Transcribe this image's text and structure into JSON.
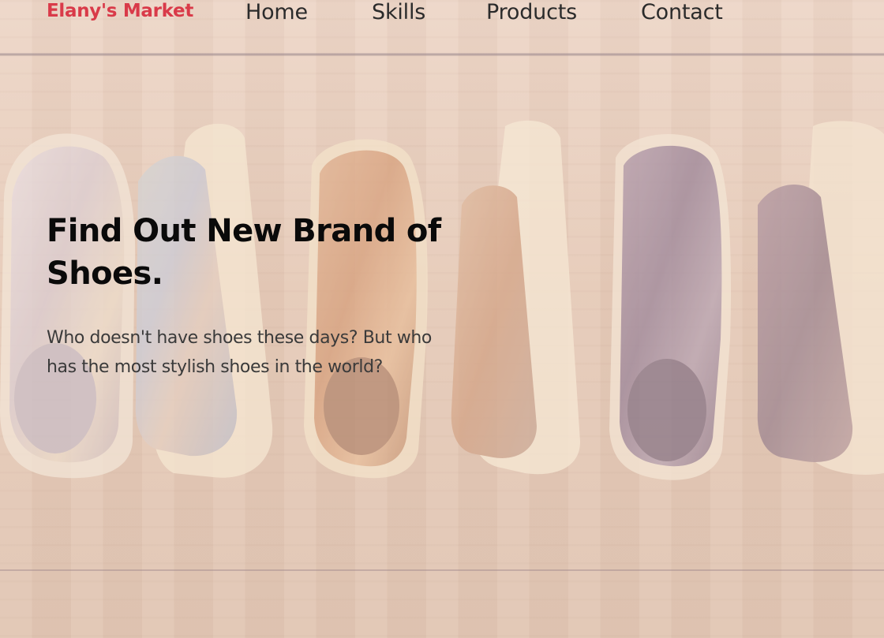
{
  "brand": {
    "name": "Elany's Market",
    "color": "#d93a49"
  },
  "nav": {
    "items": [
      {
        "label": "Home"
      },
      {
        "label": "Skills"
      },
      {
        "label": "Products"
      },
      {
        "label": "Contact"
      }
    ]
  },
  "hero": {
    "title": "Find Out New Brand of Shoes.",
    "subtitle": "Who doesn't have shoes these days? But who has the most stylish shoes in the world?"
  },
  "background": {
    "image_subject": "row-of-iridescent-sneakers-on-wood-floor"
  }
}
